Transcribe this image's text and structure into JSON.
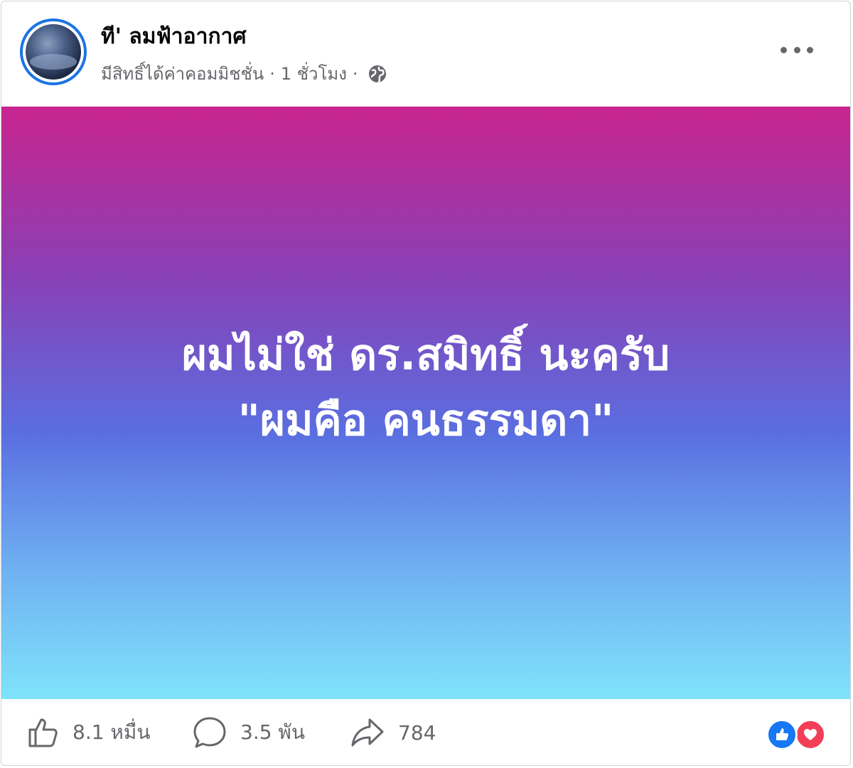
{
  "post": {
    "page_name": "ที' ลมฟ้าอากาศ",
    "meta": {
      "label": "มีสิทธิ์ได้ค่าคอมมิชชั่น",
      "separator": "·",
      "time": "1 ชั่วโมง",
      "audience_icon": "globe-icon"
    },
    "more_icon": "more-options-icon",
    "text_lines": [
      "ผมไม่ใช่ ดร.สมิทธิ์ นะครับ",
      "\"ผมคือ คนธรรมดา\""
    ],
    "background_gradient": [
      "#c9258f",
      "#8a3fb5",
      "#5a6ee0",
      "#6fb0f2",
      "#7fe3fa"
    ]
  },
  "footer": {
    "likes": "8.1 หมื่น",
    "comments": "3.5 พัน",
    "shares": "784",
    "reactions": [
      "like-reaction-icon",
      "love-reaction-icon"
    ]
  },
  "colors": {
    "brand_blue": "#1877f2",
    "love_red": "#f33e58",
    "secondary_text": "#65676b"
  }
}
